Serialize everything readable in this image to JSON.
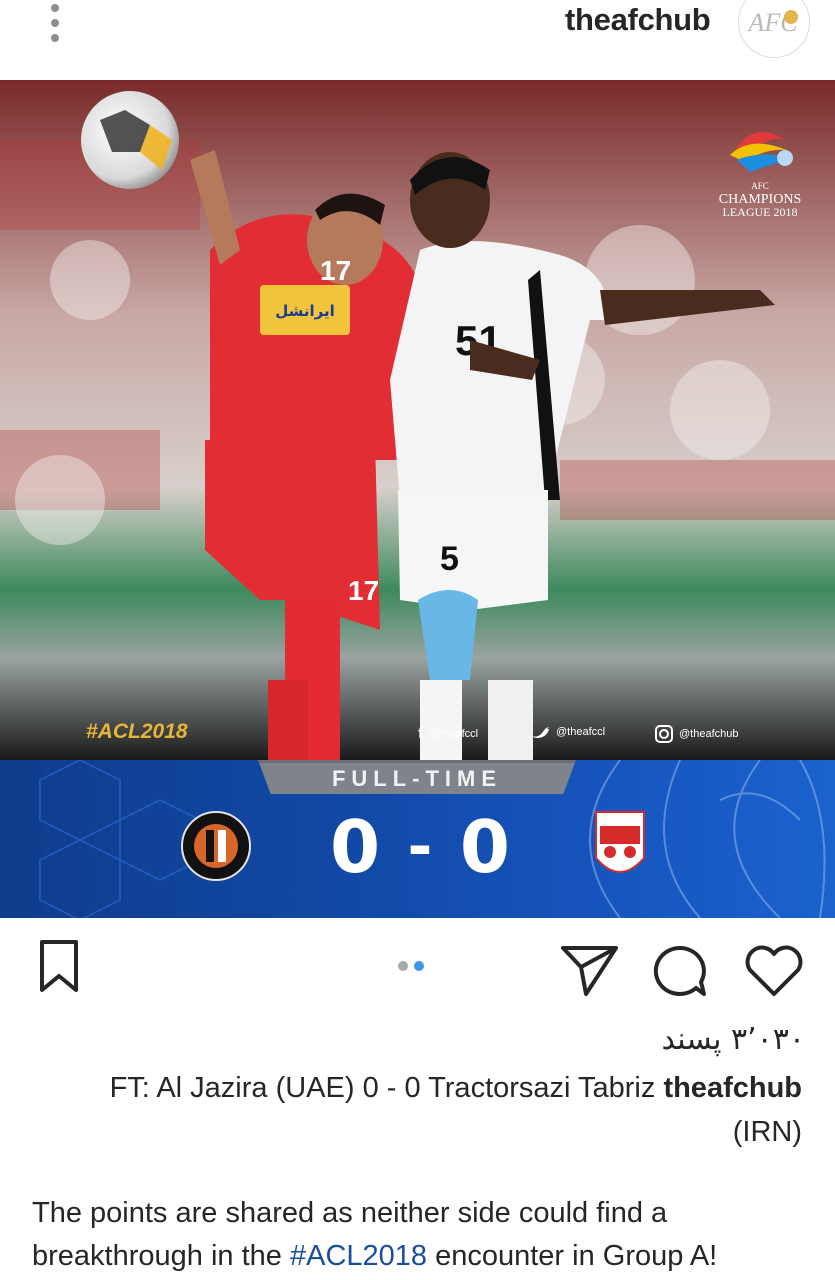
{
  "header": {
    "username": "theafchub",
    "avatar_icon": "afc-logo-icon",
    "avatar_text": "AFC",
    "more_icon": "more-vertical-icon"
  },
  "post": {
    "image": {
      "overlay_hashtag": "#ACL2018",
      "socials": {
        "facebook": "@theafccl",
        "twitter": "@theafccl",
        "instagram": "@theafchub"
      },
      "competition_logo_line1": "AFC",
      "competition_logo_line2": "CHAMPIONS",
      "competition_logo_line3": "LEAGUE 2018",
      "player_numbers": {
        "red": "17",
        "white": "51",
        "white_shorts": "5"
      },
      "banner": {
        "status": "FULL-TIME",
        "home_score": "0",
        "separator": "-",
        "away_score": "0",
        "home_team_icon": "al-jazira-club-crest-icon",
        "away_team_icon": "tractor-sazi-crest-icon"
      }
    },
    "carousel": {
      "count": 2,
      "active_index": 1
    },
    "actions": {
      "bookmark_icon": "bookmark-icon",
      "share_icon": "send-icon",
      "comment_icon": "comment-icon",
      "like_icon": "heart-icon"
    },
    "likes_text": "۳٬۰۳۰ پسند",
    "caption": {
      "text": "FT: Al Jazira (UAE) 0 - 0 Tractorsazi Tabriz",
      "username": "theafchub",
      "text_cont": "(IRN)"
    },
    "caption_body": {
      "part1": "The points are shared as neither side could find a breakthrough in the ",
      "hashtag": "#ACL2018",
      "part2": " encounter in Group A!"
    }
  },
  "colors": {
    "link_blue": "#1b4f9c",
    "active_dot": "#3897f0",
    "banner_blue": "#124aa8",
    "hashtag_gold": "#e8b53b"
  }
}
